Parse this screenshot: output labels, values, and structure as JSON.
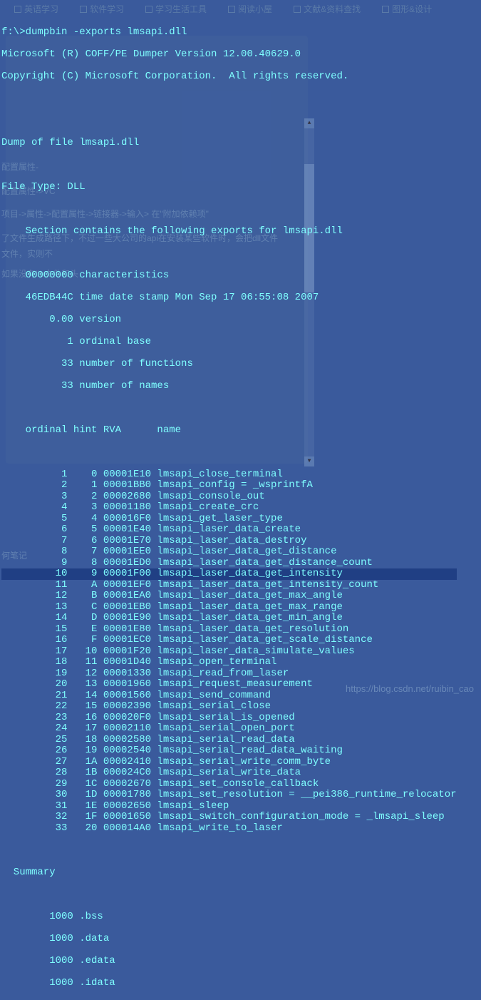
{
  "tabs": [
    "英语学习",
    "软件学习",
    "学习生活工具",
    "阅读小屋",
    "文献&资料查找",
    "图形&设计"
  ],
  "command": "f:\\>dumpbin -exports lmsapi.dll",
  "header1": "Microsoft (R) COFF/PE Dumper Version 12.00.40629.0",
  "header2": "Copyright (C) Microsoft Corporation.  All rights reserved.",
  "dump_of": "Dump of file lmsapi.dll",
  "file_type": "File Type: DLL",
  "section_msg": "    Section contains the following exports for lmsapi.dll",
  "characteristics": "    00000000 characteristics",
  "timestamp": "    46EDB44C time date stamp Mon Sep 17 06:55:08 2007",
  "version": "        0.00 version",
  "ordinal_base": "           1 ordinal base",
  "num_funcs": "          33 number of functions",
  "num_names": "          33 number of names",
  "table_header": "    ordinal hint RVA      name",
  "exports": [
    {
      "ord": "1",
      "hint": "0",
      "rva": "00001E10",
      "name": "lmsapi_close_terminal"
    },
    {
      "ord": "2",
      "hint": "1",
      "rva": "00001BB0",
      "name": "lmsapi_config = _wsprintfA"
    },
    {
      "ord": "3",
      "hint": "2",
      "rva": "00002680",
      "name": "lmsapi_console_out"
    },
    {
      "ord": "4",
      "hint": "3",
      "rva": "00001180",
      "name": "lmsapi_create_crc"
    },
    {
      "ord": "5",
      "hint": "4",
      "rva": "000016F0",
      "name": "lmsapi_get_laser_type"
    },
    {
      "ord": "6",
      "hint": "5",
      "rva": "00001E40",
      "name": "lmsapi_laser_data_create"
    },
    {
      "ord": "7",
      "hint": "6",
      "rva": "00001E70",
      "name": "lmsapi_laser_data_destroy"
    },
    {
      "ord": "8",
      "hint": "7",
      "rva": "00001EE0",
      "name": "lmsapi_laser_data_get_distance"
    },
    {
      "ord": "9",
      "hint": "8",
      "rva": "00001ED0",
      "name": "lmsapi_laser_data_get_distance_count"
    },
    {
      "ord": "10",
      "hint": "9",
      "rva": "00001F00",
      "name": "lmsapi_laser_data_get_intensity"
    },
    {
      "ord": "11",
      "hint": "A",
      "rva": "00001EF0",
      "name": "lmsapi_laser_data_get_intensity_count"
    },
    {
      "ord": "12",
      "hint": "B",
      "rva": "00001EA0",
      "name": "lmsapi_laser_data_get_max_angle"
    },
    {
      "ord": "13",
      "hint": "C",
      "rva": "00001EB0",
      "name": "lmsapi_laser_data_get_max_range"
    },
    {
      "ord": "14",
      "hint": "D",
      "rva": "00001E90",
      "name": "lmsapi_laser_data_get_min_angle"
    },
    {
      "ord": "15",
      "hint": "E",
      "rva": "00001E80",
      "name": "lmsapi_laser_data_get_resolution"
    },
    {
      "ord": "16",
      "hint": "F",
      "rva": "00001EC0",
      "name": "lmsapi_laser_data_get_scale_distance"
    },
    {
      "ord": "17",
      "hint": "10",
      "rva": "00001F20",
      "name": "lmsapi_laser_data_simulate_values"
    },
    {
      "ord": "18",
      "hint": "11",
      "rva": "00001D40",
      "name": "lmsapi_open_terminal"
    },
    {
      "ord": "19",
      "hint": "12",
      "rva": "00001330",
      "name": "lmsapi_read_from_laser"
    },
    {
      "ord": "20",
      "hint": "13",
      "rva": "00001960",
      "name": "lmsapi_request_measurement"
    },
    {
      "ord": "21",
      "hint": "14",
      "rva": "00001560",
      "name": "lmsapi_send_command"
    },
    {
      "ord": "22",
      "hint": "15",
      "rva": "00002390",
      "name": "lmsapi_serial_close"
    },
    {
      "ord": "23",
      "hint": "16",
      "rva": "000020F0",
      "name": "lmsapi_serial_is_opened"
    },
    {
      "ord": "24",
      "hint": "17",
      "rva": "00002110",
      "name": "lmsapi_serial_open_port"
    },
    {
      "ord": "25",
      "hint": "18",
      "rva": "00002580",
      "name": "lmsapi_serial_read_data"
    },
    {
      "ord": "26",
      "hint": "19",
      "rva": "00002540",
      "name": "lmsapi_serial_read_data_waiting"
    },
    {
      "ord": "27",
      "hint": "1A",
      "rva": "00002410",
      "name": "lmsapi_serial_write_comm_byte"
    },
    {
      "ord": "28",
      "hint": "1B",
      "rva": "000024C0",
      "name": "lmsapi_serial_write_data"
    },
    {
      "ord": "29",
      "hint": "1C",
      "rva": "00002670",
      "name": "lmsapi_set_console_callback"
    },
    {
      "ord": "30",
      "hint": "1D",
      "rva": "00001780",
      "name": "lmsapi_set_resolution = __pei386_runtime_relocator"
    },
    {
      "ord": "31",
      "hint": "1E",
      "rva": "00002650",
      "name": "lmsapi_sleep"
    },
    {
      "ord": "32",
      "hint": "1F",
      "rva": "00001650",
      "name": "lmsapi_switch_configuration_mode = _lmsapi_sleep"
    },
    {
      "ord": "33",
      "hint": "20",
      "rva": "000014A0",
      "name": "lmsapi_write_to_laser"
    }
  ],
  "summary_label": "  Summary",
  "summary": [
    "        1000 .bss",
    "        1000 .data",
    "        1000 .edata",
    "        1000 .idata"
  ],
  "ghost": {
    "g1": "配置属性-",
    "g2": "配置属性->VC",
    "g3": "项目->属性->配置属性->链接器->输入> 在\"附加依赖项\"",
    "g4": "了文件生成路径下，不过一些大公司的api在安装某些软件时，会把dll文件",
    "g5": "文件，实则不",
    "g6": "如果没有lib文件和头",
    "g7": "何笔记"
  },
  "watermark": "https://blog.csdn.net/ruibin_cao"
}
